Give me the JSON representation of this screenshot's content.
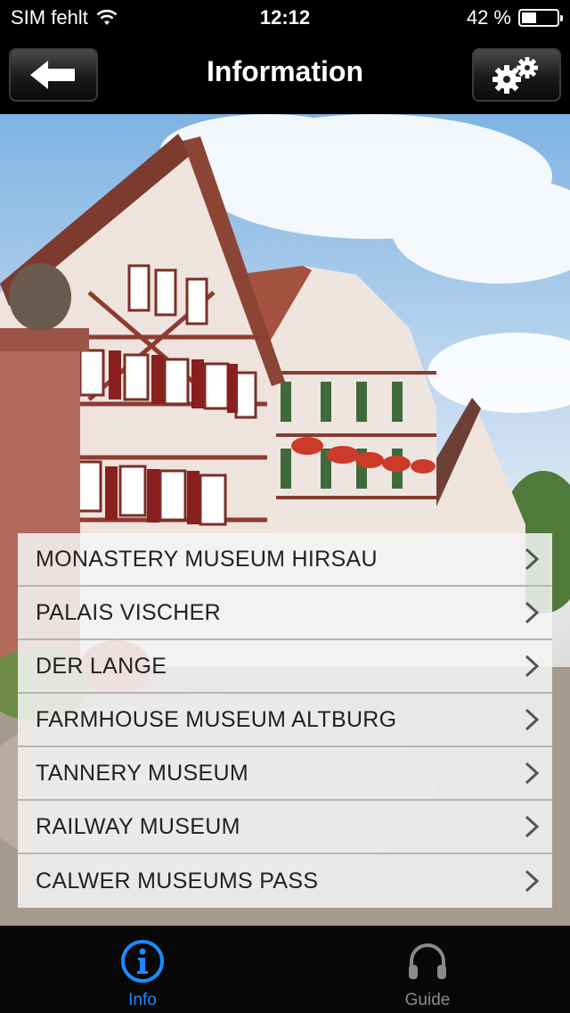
{
  "status_bar": {
    "carrier": "SIM fehlt",
    "time": "12:12",
    "battery_percent": "42 %",
    "battery_level": 0.42
  },
  "nav": {
    "title": "Information",
    "back_icon": "arrow-left-icon",
    "settings_icon": "gears-icon"
  },
  "hero": {
    "image": "half-timbered-houses-photo"
  },
  "menu": {
    "items": [
      {
        "label": "MONASTERY MUSEUM HIRSAU"
      },
      {
        "label": "PALAIS VISCHER"
      },
      {
        "label": "DER LANGE"
      },
      {
        "label": "FARMHOUSE MUSEUM ALTBURG"
      },
      {
        "label": "TANNERY MUSEUM"
      },
      {
        "label": "RAILWAY MUSEUM"
      },
      {
        "label": "CALWER MUSEUMS PASS"
      }
    ]
  },
  "tabs": {
    "info": {
      "label": "Info",
      "icon": "info-icon",
      "selected": true
    },
    "guide": {
      "label": "Guide",
      "icon": "headphones-icon",
      "selected": false
    }
  },
  "colors": {
    "accent": "#1a8cff",
    "tab_inactive": "#8a8a8a"
  }
}
